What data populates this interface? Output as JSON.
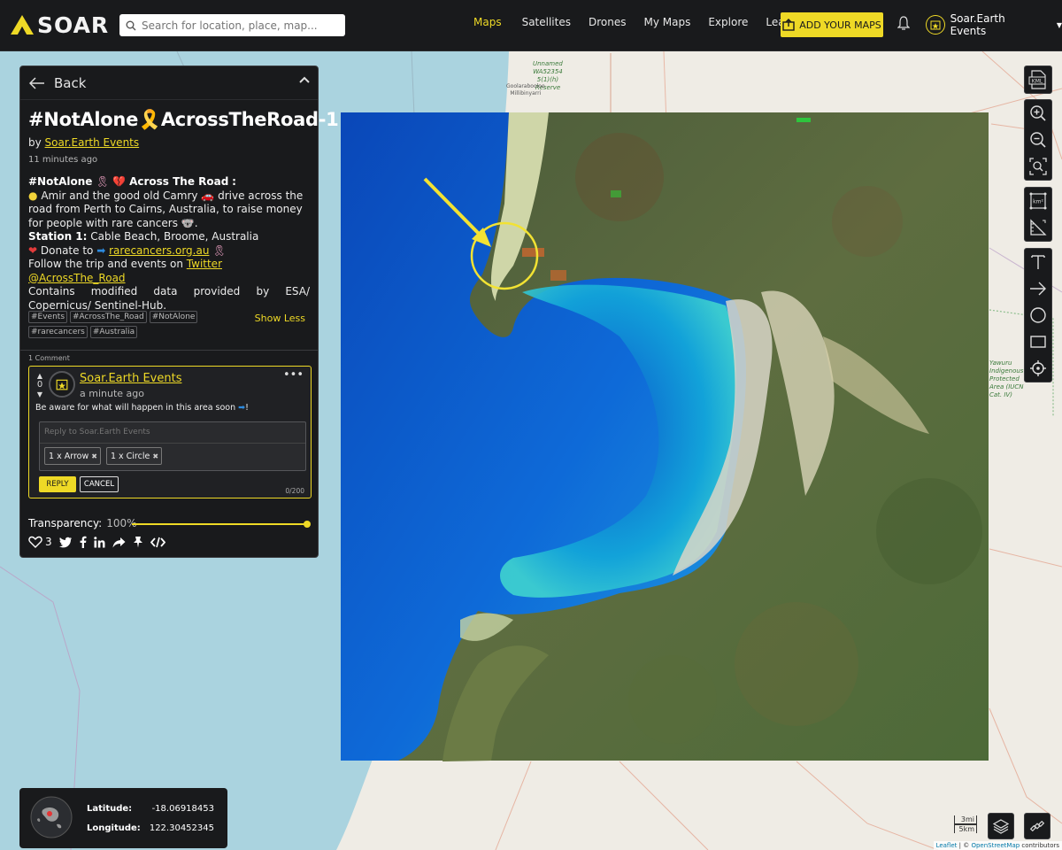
{
  "navbar": {
    "logo_text": "SOAR",
    "search_placeholder": "Search for location, place, map...",
    "nav_items": [
      "Maps",
      "Satellites",
      "Drones",
      "My Maps",
      "Explore",
      "Learn"
    ],
    "active_nav": "Maps",
    "add_button_label": "ADD YOUR MAPS",
    "user_name": "Soar.Earth Events",
    "accent_color": "#eed926"
  },
  "panel": {
    "back_label": "Back",
    "title": "#NotAlone🎗️AcrossTheRoad-1",
    "by_prefix": "by",
    "author": "Soar.Earth Events",
    "time": "11 minutes ago",
    "desc": {
      "line1_tag": "#NotAlone",
      "line1_rest": "Across The Road",
      "line2": "Amir and the good old Camry",
      "line2_rest": "drive across the road from Perth to Cairns, Australia, to raise money for people with rare cancers",
      "station_label": "Station 1:",
      "station_value": "Cable Beach, Broome, Australia",
      "donate_label": "Donate to",
      "donate_link": "rarecancers.org.au",
      "follow_label": "Follow the trip and events on",
      "follow_link": "Twitter @AcrossThe_Road",
      "credit": "Contains modified data provided by ESA/ Copernicus/ Sentinel-Hub."
    },
    "tags": [
      "#Events",
      "#AcrossThe_Road",
      "#NotAlone",
      "#rarecancers",
      "#Australia"
    ],
    "show_less": "Show Less",
    "comment_count": "1 Comment",
    "comment": {
      "votes": "0",
      "author": "Soar.Earth Events",
      "time": "a minute ago",
      "text": "Be aware for what will happen in this area soon",
      "text_end": "!",
      "reply_placeholder": "Reply to Soar.Earth Events",
      "chips": [
        "1 x Arrow",
        "1 x Circle"
      ],
      "reply_button": "REPLY",
      "cancel_button": "CANCEL",
      "char_count": "0/200"
    },
    "transparency_label": "Transparency:",
    "transparency_value": "100%",
    "transparency_level": 1.0,
    "likes": "3"
  },
  "coords": {
    "lat_label": "Latitude:",
    "lat_value": "-18.06918453",
    "lon_label": "Longitude:",
    "lon_value": "122.30452345"
  },
  "scale": {
    "imperial": "3mi",
    "metric": "5km"
  },
  "attribution": {
    "leaflet": "Leaflet",
    "sep": " | © ",
    "osm": "OpenStreetMap",
    "tail": " contributors"
  },
  "map_labels": {
    "label_a": "Unnamed",
    "label_b": "WA52354",
    "label_c": "5(1)(h)",
    "label_d": "Reserve",
    "label_e": "Goolarabooloo",
    "label_f": "Millibinyarri",
    "label_g": "Yawuru",
    "label_h": "Indigenous",
    "label_i": "Protected",
    "label_j": "Area (IUCN",
    "label_k": "Cat. IV)",
    "kml": "KML",
    "km2": "km²"
  }
}
